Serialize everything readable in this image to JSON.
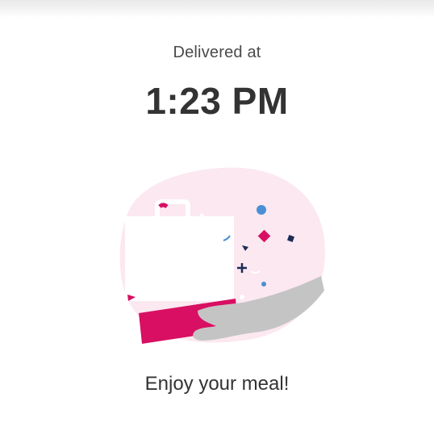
{
  "delivery": {
    "label": "Delivered at",
    "time": "1:23 PM",
    "message": "Enjoy your meal!"
  },
  "illustration": {
    "name": "delivered-bag-illustration",
    "colors": {
      "blob": "#fce8f0",
      "bag": "#ffffff",
      "box": "#d80f62",
      "hand": "#c4c4c4",
      "confetti_blue": "#4a8fd6",
      "confetti_navy": "#1d2b57",
      "confetti_pink": "#d80f62"
    }
  }
}
